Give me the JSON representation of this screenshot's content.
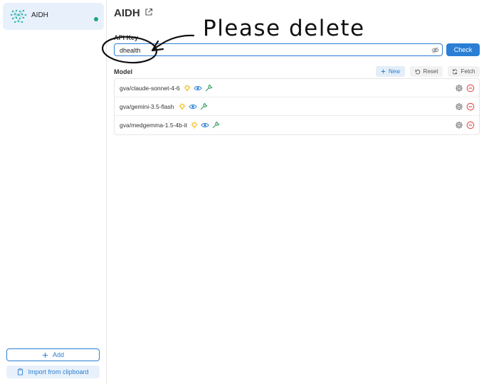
{
  "sidebar": {
    "provider": {
      "name": "AIDH",
      "status_color": "#1aa67a",
      "logo_color": "#2bb5b0"
    },
    "add_label": "Add",
    "import_label": "Import from clipboard"
  },
  "main": {
    "title": "AIDH",
    "api_key": {
      "label": "API Key",
      "value": "dhealth"
    },
    "check_label": "Check",
    "model": {
      "label": "Model",
      "new_label": "New",
      "reset_label": "Reset",
      "fetch_label": "Fetch",
      "rows": [
        {
          "name": "gva/claude-sonnet-4-6"
        },
        {
          "name": "gva/gemini-3.5-flash"
        },
        {
          "name": "gva/medgemma-1.5-4b-it"
        }
      ]
    }
  },
  "annotation": {
    "text": "Please delete"
  },
  "colors": {
    "accent": "#2a7fd4",
    "reasoning": "#f0b400",
    "vision": "#2a7fd4",
    "tools": "#2e9e5a",
    "remove": "#e04646"
  }
}
